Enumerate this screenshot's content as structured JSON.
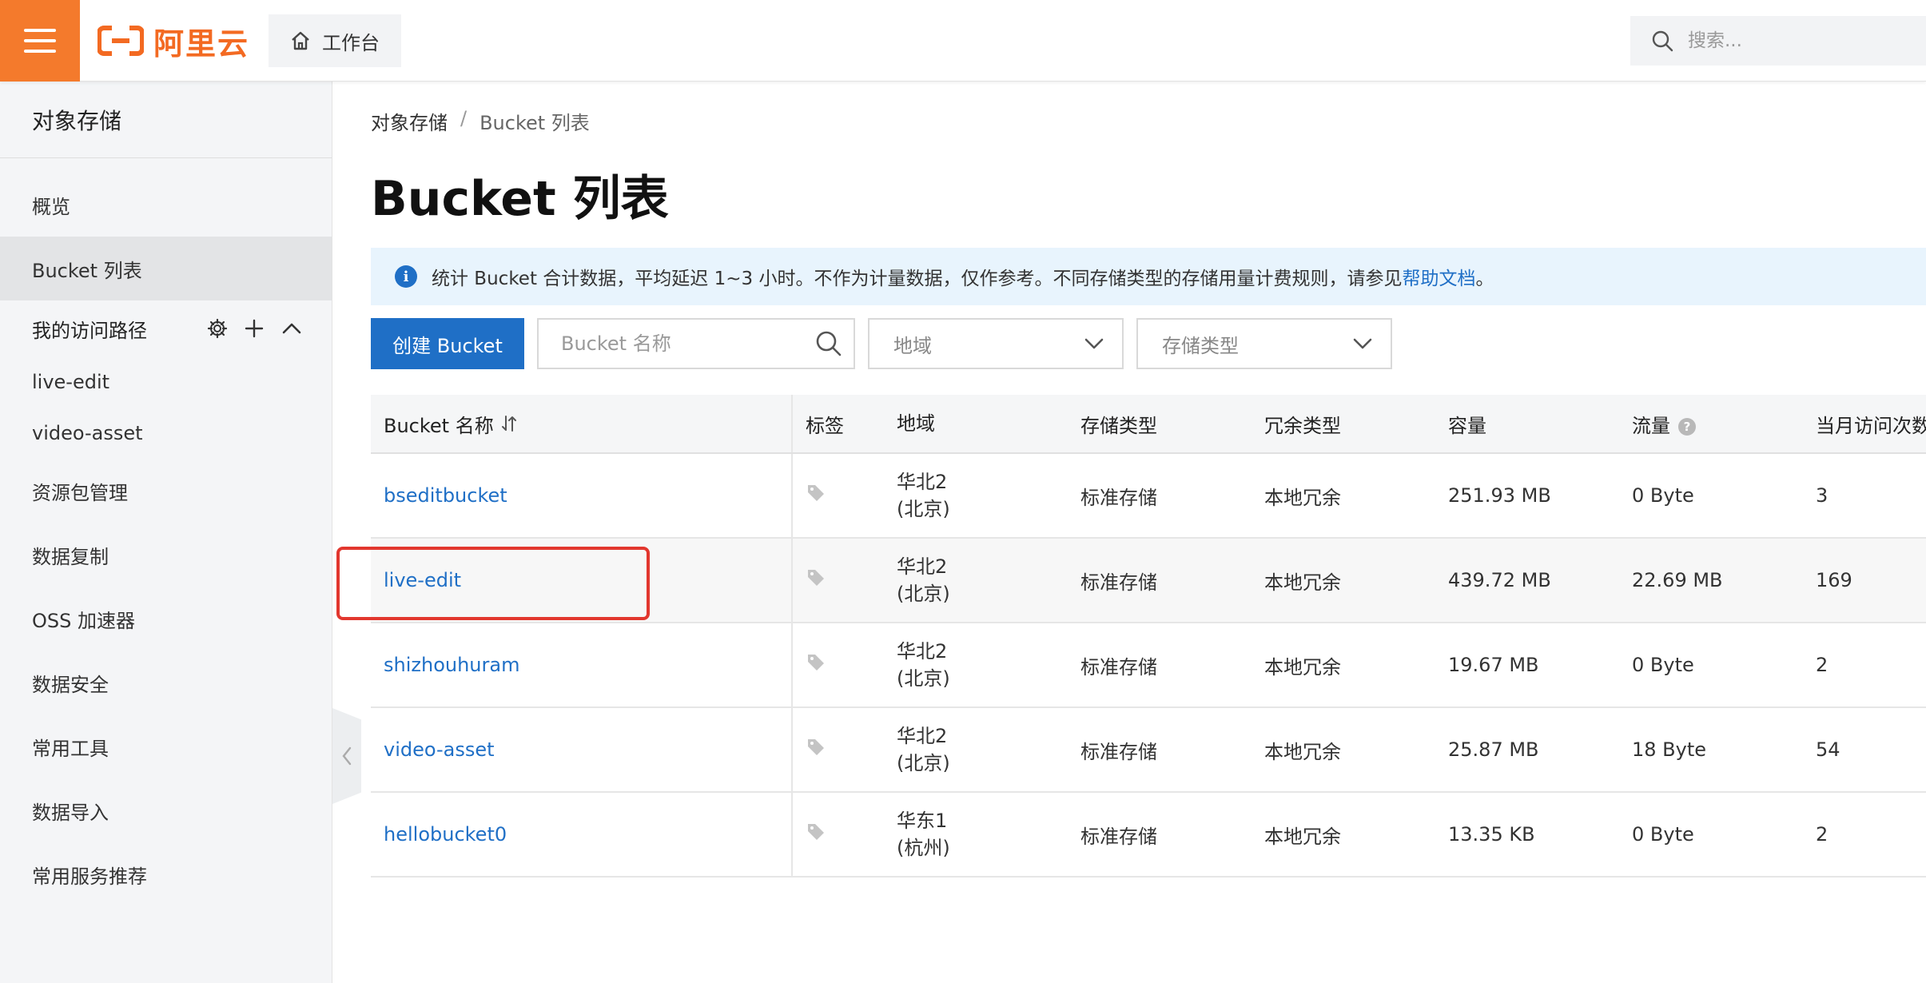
{
  "header": {
    "logo_text": "阿里云",
    "workbench_label": "工作台",
    "search_placeholder": "搜索..."
  },
  "sidebar": {
    "title": "对象存储",
    "items_top": [
      {
        "label": "概览"
      },
      {
        "label": "Bucket 列表",
        "active": true
      }
    ],
    "section_label": "我的访问路径",
    "paths": [
      {
        "label": "live-edit"
      },
      {
        "label": "video-asset"
      }
    ],
    "items_bottom": [
      {
        "label": "资源包管理"
      },
      {
        "label": "数据复制"
      },
      {
        "label": "OSS 加速器"
      },
      {
        "label": "数据安全"
      },
      {
        "label": "常用工具"
      },
      {
        "label": "数据导入"
      },
      {
        "label": "常用服务推荐"
      }
    ]
  },
  "main": {
    "breadcrumb": [
      "对象存储",
      "Bucket 列表"
    ],
    "breadcrumb_sep": "/",
    "title": "Bucket 列表",
    "notice_text": "统计 Bucket 合计数据，平均延迟 1~3 小时。不作为计量数据，仅作参考。不同存储类型的存储用量计费规则，请参见",
    "notice_link": "帮助文档",
    "notice_end": "。",
    "create_button": "创建 Bucket",
    "name_search_placeholder": "Bucket 名称",
    "region_placeholder": "地域",
    "storage_type_placeholder": "存储类型",
    "columns": [
      "Bucket 名称",
      "标签",
      "地域",
      "存储类型",
      "冗余类型",
      "容量",
      "流量",
      "当月访问次数"
    ],
    "rows": [
      {
        "name": "bseditbucket",
        "region1": "华北2",
        "region2": "(北京)",
        "storage": "标准存储",
        "redundancy": "本地冗余",
        "capacity": "251.93 MB",
        "traffic": "0 Byte",
        "visits": "3"
      },
      {
        "name": "live-edit",
        "region1": "华北2",
        "region2": "(北京)",
        "storage": "标准存储",
        "redundancy": "本地冗余",
        "capacity": "439.72 MB",
        "traffic": "22.69 MB",
        "visits": "169"
      },
      {
        "name": "shizhouhuram",
        "region1": "华北2",
        "region2": "(北京)",
        "storage": "标准存储",
        "redundancy": "本地冗余",
        "capacity": "19.67 MB",
        "traffic": "0 Byte",
        "visits": "2"
      },
      {
        "name": "video-asset",
        "region1": "华北2",
        "region2": "(北京)",
        "storage": "标准存储",
        "redundancy": "本地冗余",
        "capacity": "25.87 MB",
        "traffic": "18 Byte",
        "visits": "54"
      },
      {
        "name": "hellobucket0",
        "region1": "华东1",
        "region2": "(杭州)",
        "storage": "标准存储",
        "redundancy": "本地冗余",
        "capacity": "13.35 KB",
        "traffic": "0 Byte",
        "visits": "2"
      }
    ]
  },
  "colors": {
    "brand_orange": "#f47a2c",
    "link_blue": "#1f6fc6",
    "highlight_red": "#e2372e"
  }
}
